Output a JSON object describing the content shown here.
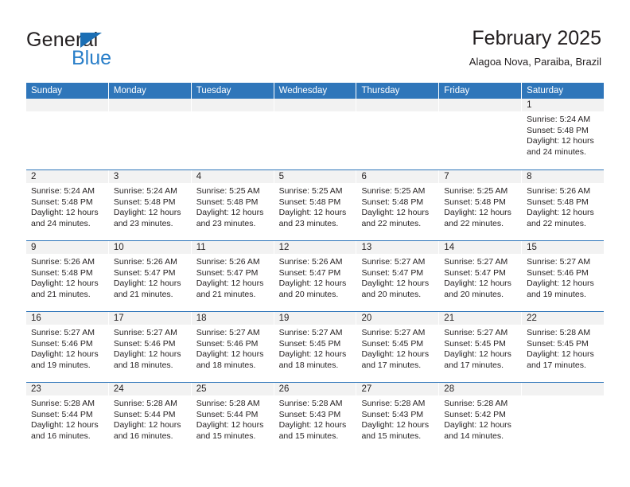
{
  "logo": {
    "word_top": "General",
    "word_bottom": "Blue",
    "triangle_icon": "blue-triangle-icon",
    "accent_color": "#2a7fc9"
  },
  "header": {
    "title": "February 2025",
    "subtitle": "Alagoa Nova, Paraiba, Brazil"
  },
  "theme": {
    "header_blue": "#2f76ba",
    "day_band_gray": "#f2f2f2",
    "text_color": "#231f20"
  },
  "calendar": {
    "weekdays": [
      "Sunday",
      "Monday",
      "Tuesday",
      "Wednesday",
      "Thursday",
      "Friday",
      "Saturday"
    ],
    "weeks": [
      [
        {
          "day": "",
          "lines": []
        },
        {
          "day": "",
          "lines": []
        },
        {
          "day": "",
          "lines": []
        },
        {
          "day": "",
          "lines": []
        },
        {
          "day": "",
          "lines": []
        },
        {
          "day": "",
          "lines": []
        },
        {
          "day": "1",
          "lines": [
            "Sunrise: 5:24 AM",
            "Sunset: 5:48 PM",
            "Daylight: 12 hours",
            "and 24 minutes."
          ]
        }
      ],
      [
        {
          "day": "2",
          "lines": [
            "Sunrise: 5:24 AM",
            "Sunset: 5:48 PM",
            "Daylight: 12 hours",
            "and 24 minutes."
          ]
        },
        {
          "day": "3",
          "lines": [
            "Sunrise: 5:24 AM",
            "Sunset: 5:48 PM",
            "Daylight: 12 hours",
            "and 23 minutes."
          ]
        },
        {
          "day": "4",
          "lines": [
            "Sunrise: 5:25 AM",
            "Sunset: 5:48 PM",
            "Daylight: 12 hours",
            "and 23 minutes."
          ]
        },
        {
          "day": "5",
          "lines": [
            "Sunrise: 5:25 AM",
            "Sunset: 5:48 PM",
            "Daylight: 12 hours",
            "and 23 minutes."
          ]
        },
        {
          "day": "6",
          "lines": [
            "Sunrise: 5:25 AM",
            "Sunset: 5:48 PM",
            "Daylight: 12 hours",
            "and 22 minutes."
          ]
        },
        {
          "day": "7",
          "lines": [
            "Sunrise: 5:25 AM",
            "Sunset: 5:48 PM",
            "Daylight: 12 hours",
            "and 22 minutes."
          ]
        },
        {
          "day": "8",
          "lines": [
            "Sunrise: 5:26 AM",
            "Sunset: 5:48 PM",
            "Daylight: 12 hours",
            "and 22 minutes."
          ]
        }
      ],
      [
        {
          "day": "9",
          "lines": [
            "Sunrise: 5:26 AM",
            "Sunset: 5:48 PM",
            "Daylight: 12 hours",
            "and 21 minutes."
          ]
        },
        {
          "day": "10",
          "lines": [
            "Sunrise: 5:26 AM",
            "Sunset: 5:47 PM",
            "Daylight: 12 hours",
            "and 21 minutes."
          ]
        },
        {
          "day": "11",
          "lines": [
            "Sunrise: 5:26 AM",
            "Sunset: 5:47 PM",
            "Daylight: 12 hours",
            "and 21 minutes."
          ]
        },
        {
          "day": "12",
          "lines": [
            "Sunrise: 5:26 AM",
            "Sunset: 5:47 PM",
            "Daylight: 12 hours",
            "and 20 minutes."
          ]
        },
        {
          "day": "13",
          "lines": [
            "Sunrise: 5:27 AM",
            "Sunset: 5:47 PM",
            "Daylight: 12 hours",
            "and 20 minutes."
          ]
        },
        {
          "day": "14",
          "lines": [
            "Sunrise: 5:27 AM",
            "Sunset: 5:47 PM",
            "Daylight: 12 hours",
            "and 20 minutes."
          ]
        },
        {
          "day": "15",
          "lines": [
            "Sunrise: 5:27 AM",
            "Sunset: 5:46 PM",
            "Daylight: 12 hours",
            "and 19 minutes."
          ]
        }
      ],
      [
        {
          "day": "16",
          "lines": [
            "Sunrise: 5:27 AM",
            "Sunset: 5:46 PM",
            "Daylight: 12 hours",
            "and 19 minutes."
          ]
        },
        {
          "day": "17",
          "lines": [
            "Sunrise: 5:27 AM",
            "Sunset: 5:46 PM",
            "Daylight: 12 hours",
            "and 18 minutes."
          ]
        },
        {
          "day": "18",
          "lines": [
            "Sunrise: 5:27 AM",
            "Sunset: 5:46 PM",
            "Daylight: 12 hours",
            "and 18 minutes."
          ]
        },
        {
          "day": "19",
          "lines": [
            "Sunrise: 5:27 AM",
            "Sunset: 5:45 PM",
            "Daylight: 12 hours",
            "and 18 minutes."
          ]
        },
        {
          "day": "20",
          "lines": [
            "Sunrise: 5:27 AM",
            "Sunset: 5:45 PM",
            "Daylight: 12 hours",
            "and 17 minutes."
          ]
        },
        {
          "day": "21",
          "lines": [
            "Sunrise: 5:27 AM",
            "Sunset: 5:45 PM",
            "Daylight: 12 hours",
            "and 17 minutes."
          ]
        },
        {
          "day": "22",
          "lines": [
            "Sunrise: 5:28 AM",
            "Sunset: 5:45 PM",
            "Daylight: 12 hours",
            "and 17 minutes."
          ]
        }
      ],
      [
        {
          "day": "23",
          "lines": [
            "Sunrise: 5:28 AM",
            "Sunset: 5:44 PM",
            "Daylight: 12 hours",
            "and 16 minutes."
          ]
        },
        {
          "day": "24",
          "lines": [
            "Sunrise: 5:28 AM",
            "Sunset: 5:44 PM",
            "Daylight: 12 hours",
            "and 16 minutes."
          ]
        },
        {
          "day": "25",
          "lines": [
            "Sunrise: 5:28 AM",
            "Sunset: 5:44 PM",
            "Daylight: 12 hours",
            "and 15 minutes."
          ]
        },
        {
          "day": "26",
          "lines": [
            "Sunrise: 5:28 AM",
            "Sunset: 5:43 PM",
            "Daylight: 12 hours",
            "and 15 minutes."
          ]
        },
        {
          "day": "27",
          "lines": [
            "Sunrise: 5:28 AM",
            "Sunset: 5:43 PM",
            "Daylight: 12 hours",
            "and 15 minutes."
          ]
        },
        {
          "day": "28",
          "lines": [
            "Sunrise: 5:28 AM",
            "Sunset: 5:42 PM",
            "Daylight: 12 hours",
            "and 14 minutes."
          ]
        },
        {
          "day": "",
          "lines": []
        }
      ]
    ]
  }
}
